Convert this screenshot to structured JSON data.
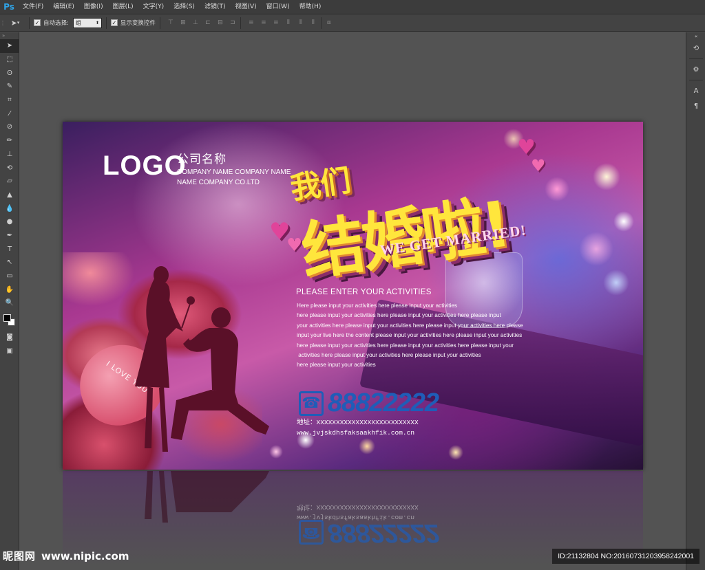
{
  "app": {
    "logo": "Ps"
  },
  "menu": [
    "文件(F)",
    "编辑(E)",
    "图像(I)",
    "图层(L)",
    "文字(Y)",
    "选择(S)",
    "滤镜(T)",
    "视图(V)",
    "窗口(W)",
    "帮助(H)"
  ],
  "options": {
    "auto_select_label": "自动选择:",
    "auto_select_value": "组",
    "show_transform_label": "显示变换控件"
  },
  "poster": {
    "logo": "LOGO",
    "company_cn": "公司名称",
    "company_en_line1": "COMPANY NAME COMPANY NAME",
    "company_en_line2": "NAME COMPANY CO.LTD",
    "headline_line1": "我们",
    "headline_line2": "结婚啦!",
    "headline_en": "WE GET MARRIED!",
    "heart_text": "I LOVE YOU",
    "activity_title": "PLEASE ENTER YOUR ACTIVITIES",
    "activity_lines": [
      "Here please input your activities here please input your activities",
      "here please input your activities here please input your activities here please input",
      "your activities here please input your activities here please input your activities here please",
      "input your live here the content please input your activities here please input your activities",
      "here please input your activities here please input your activities here please input your",
      " activities here please input your activities here please input your activities",
      "here please input your activities"
    ],
    "phone": "88822222",
    "address_line1": "地址：XXXXXXXXXXXXXXXXXXXXXXXXXX",
    "address_line2": "www.jvjskdhsfaksaakhfik.com.cn"
  },
  "watermark": {
    "site_cn": "昵图网",
    "site_url": "www.nipic.com",
    "id_text": "ID:21132804 NO:20160731203958242001"
  },
  "colors": {
    "phone_blue": "#1f5db8",
    "headline_yellow": "#ffe63c",
    "ps_blue": "#2fa3e6"
  }
}
